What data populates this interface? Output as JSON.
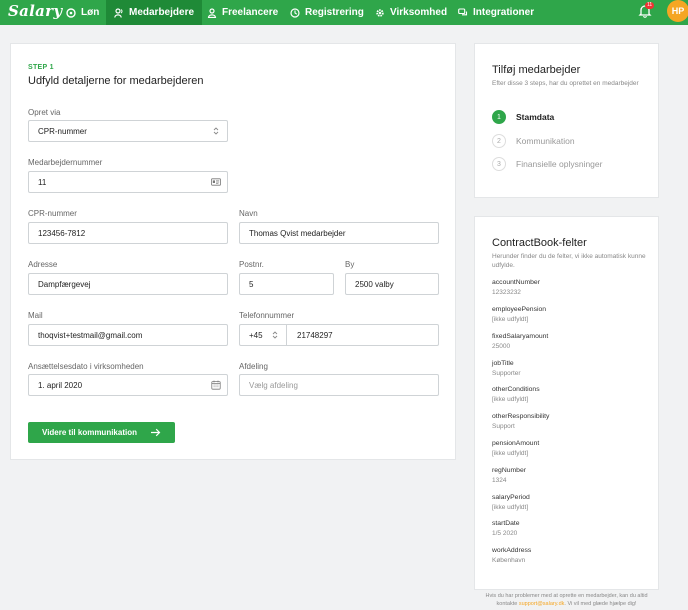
{
  "brand": {
    "name": "Salary",
    "green": "#2fa64a",
    "orange": "#f5a623"
  },
  "nav": {
    "items": [
      {
        "label": "Løn",
        "icon": "money-icon"
      },
      {
        "label": "Medarbejdere",
        "icon": "users-icon",
        "active": true
      },
      {
        "label": "Freelancere",
        "icon": "user-icon"
      },
      {
        "label": "Registrering",
        "icon": "clock-icon"
      },
      {
        "label": "Virksomhed",
        "icon": "gear-icon"
      },
      {
        "label": "Integrationer",
        "icon": "chat-icon"
      }
    ],
    "notification_count": "11",
    "avatar_initials": "HP"
  },
  "form": {
    "step": "STEP 1",
    "title": "Udfyld detaljerne for medarbejderen",
    "create_via": {
      "label": "Opret via",
      "value": "CPR-nummer"
    },
    "employee_number": {
      "label": "Medarbejdernummer",
      "value": "11"
    },
    "cpr": {
      "label": "CPR-nummer",
      "value": "123456-7812"
    },
    "name": {
      "label": "Navn",
      "value": "Thomas Qvist medarbejder"
    },
    "address": {
      "label": "Adresse",
      "value": "Dampfærgevej"
    },
    "postal": {
      "label": "Postnr.",
      "value": "5"
    },
    "city": {
      "label": "By",
      "value": "2500 valby"
    },
    "mail": {
      "label": "Mail",
      "value": "thoqvist+testmail@gmail.com"
    },
    "phone": {
      "label": "Telefonnummer",
      "prefix": "+45",
      "value": "21748297"
    },
    "employment_date": {
      "label": "Ansættelsesdato i virksomheden",
      "value": "1. april 2020"
    },
    "department": {
      "label": "Afdeling",
      "placeholder": "Vælg afdeling"
    },
    "continue_label": "Videre til kommunikation"
  },
  "steps_panel": {
    "title": "Tilføj medarbejder",
    "subtitle": "Efter disse 3 steps, har du oprettet en medarbejder",
    "steps": [
      {
        "num": "1",
        "label": "Stamdata",
        "active": true
      },
      {
        "num": "2",
        "label": "Kommunikation"
      },
      {
        "num": "3",
        "label": "Finansielle oplysninger"
      }
    ]
  },
  "contractbook": {
    "title": "ContractBook-felter",
    "subtitle": "Herunder finder du de felter, vi ikke automatisk kunne udfylde.",
    "fields": [
      {
        "key": "accountNumber",
        "value": "12323232"
      },
      {
        "key": "employeePension",
        "value": "[ikke udfyldt]"
      },
      {
        "key": "fixedSalaryamount",
        "value": "25000"
      },
      {
        "key": "jobTitle",
        "value": "Supporter"
      },
      {
        "key": "otherConditions",
        "value": "[ikke udfyldt]"
      },
      {
        "key": "otherResponsibility",
        "value": "Support"
      },
      {
        "key": "pensionAmount",
        "value": "[ikke udfyldt]"
      },
      {
        "key": "regNumber",
        "value": "1324"
      },
      {
        "key": "salaryPeriod",
        "value": "[ikke udfyldt]"
      },
      {
        "key": "startDate",
        "value": "1/5 2020"
      },
      {
        "key": "workAddress",
        "value": "København"
      }
    ]
  },
  "footer": {
    "line1": "Hvis du har problemer med at oprette en medarbejder, kan du altid",
    "line2_prefix": "kontakte",
    "email": "support@salary.dk",
    "line2_suffix": ". Vi vil med glæde hjælpe dig!"
  }
}
